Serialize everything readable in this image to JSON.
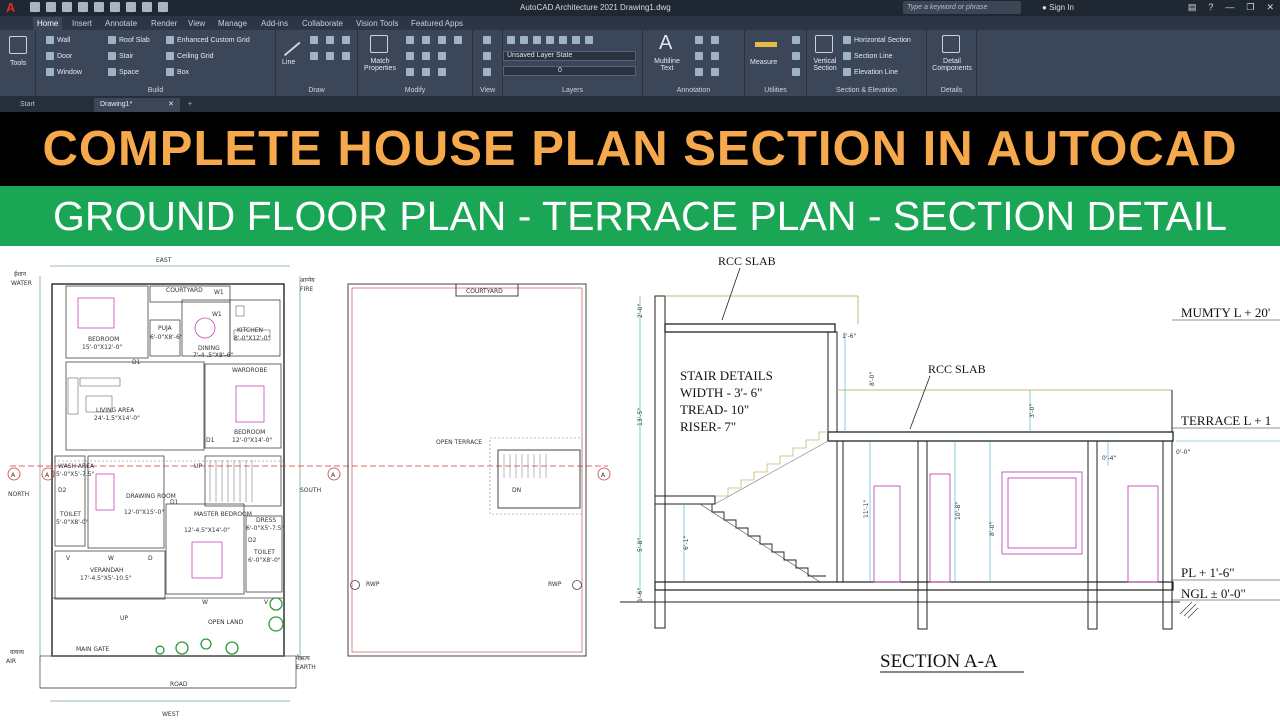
{
  "titlebar": {
    "app_title": "AutoCAD Architecture 2021    Drawing1.dwg",
    "search_placeholder": "Type a keyword or phrase",
    "sign_in": "Sign In"
  },
  "ribbon_tabs": [
    "Home",
    "Insert",
    "Annotate",
    "Render",
    "View",
    "Manage",
    "Add-ins",
    "Collaborate",
    "Vision Tools",
    "Featured Apps"
  ],
  "ribbon": {
    "tools_label": "Tools",
    "build": {
      "title": "Build",
      "items": [
        "Wall",
        "Door",
        "Window",
        "Roof Slab",
        "Stair",
        "Space",
        "Enhanced Custom Grid",
        "Ceiling Grid",
        "Box"
      ]
    },
    "draw": {
      "title": "Draw",
      "line": "Line"
    },
    "modify": {
      "title": "Modify",
      "match": "Match Properties"
    },
    "view": {
      "title": "View"
    },
    "layers": {
      "title": "Layers",
      "layer_state": "Unsaved Layer State",
      "current_layer": "0"
    },
    "annotation": {
      "title": "Annotation",
      "multiline": "Multiline Text"
    },
    "utilities": {
      "title": "Utilities",
      "measure": "Measure"
    },
    "section": {
      "title": "Section & Elevation",
      "vertical": "Vertical Section",
      "horizontal": "Horizontal Section",
      "section_line": "Section Line",
      "elevation_line": "Elevation Line"
    },
    "details": {
      "title": "Details",
      "detail_components": "Detail Components"
    }
  },
  "file_tabs": {
    "start": "Start",
    "drawing": "Drawing1*"
  },
  "banner_title": "COMPLETE HOUSE PLAN SECTION IN AUTOCAD",
  "banner_subtitle": "GROUND FLOOR PLAN - TERRACE PLAN - SECTION DETAIL",
  "ground_plan": {
    "east": "EAST",
    "west": "WEST",
    "north": "NORTH",
    "south": "SOUTH",
    "water": "WATER",
    "water_hi": "ईशान",
    "fire": "FIRE",
    "fire_hi": "आग्नेय",
    "air": "AIR",
    "air_hi": "वायव्य",
    "earth": "EARTH",
    "earth_hi": "नैऋत्य",
    "rooms": {
      "bedroom1": "BEDROOM",
      "bedroom1_size": "15'-0\"X12'-0\"",
      "courtyard": "COURTYARD",
      "puja": "PUJA",
      "puja_size": "6'-0\"X8'-6\"",
      "dining": "DINING",
      "dining_size": "7'-4 .5\"X8'-6\"",
      "kitchen": "KITCHEN",
      "kitchen_size": "8'-0\"X12'-0\"",
      "wardrobe": "WARDROBE",
      "living": "LIVING AREA",
      "living_size": "24'-1.5\"X14'-0\"",
      "bedroom2": "BEDROOM",
      "bedroom2_size": "12'-0\"X14'-0\"",
      "wash": "WASH AREA",
      "wash_size": "5'-0\"X5'-7.5\"",
      "toilet1": "TOILET",
      "toilet1_size": "5'-0\"X8'-0\"",
      "drawing": "DRAWING ROOM",
      "drawing_size": "12'-0\"X15'-0\"",
      "master": "MASTER BEDROOM",
      "master_size": "12'-4.5\"X14'-0\"",
      "dress": "DRESS",
      "dress_size": "6'-0\"X5'-7.5\"",
      "toilet2": "TOILET",
      "toilet2_size": "6'-0\"X8'-0\"",
      "verandah": "VERANDAH",
      "verandah_size": "17'-4.5\"X5'-10.5\"",
      "open_land": "OPEN LAND",
      "main_gate": "MAIN GATE",
      "road": "ROAD"
    },
    "tags": {
      "d1": "D1",
      "d2": "D2",
      "w": "W",
      "w1": "W1",
      "d": "D",
      "v": "V",
      "up": "UP"
    },
    "section_marker": "A"
  },
  "terrace_plan": {
    "courtyard": "COURTYARD",
    "open_terrace": "OPEN TERRACE",
    "rwp": "RWP",
    "dn": "DN"
  },
  "section": {
    "title": "SECTION A-A",
    "rcc_slab_top": "RCC SLAB",
    "rcc_slab_mid": "RCC SLAB",
    "stair_title": "STAIR DETAILS",
    "stair_width": "WIDTH - 3'- 6\"",
    "stair_tread": "TREAD- 10\"",
    "stair_riser": "RISER- 7\"",
    "mumty": "MUMTY L + 20'",
    "terrace": "TERRACE L + 1",
    "pl": "PL + 1'-6\"",
    "ngl": "NGL ± 0'-0\"",
    "dims": {
      "d_2_0": "2'-0\"",
      "d_13_5": "13'-5\"",
      "d_5_8": "5'-8\"",
      "d_1_6": "1'-6\"",
      "d_8_0a": "8'-0\"",
      "d_3_0": "3'-0\"",
      "d_6_1": "6'-1\"",
      "d_11_1": "11'-1\"",
      "d_10_8": "10'-8\"",
      "d_8_0b": "8'-0\"",
      "d_1_6b": "1'-6\"",
      "d_0_4": "0'-4\"",
      "d_0_0": "0'-0\""
    }
  }
}
